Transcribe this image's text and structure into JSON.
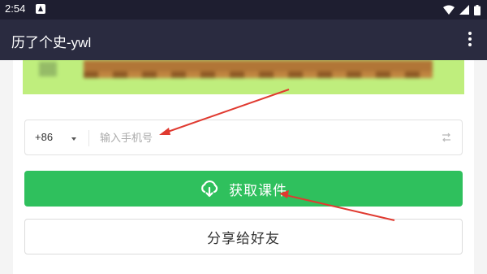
{
  "status_bar": {
    "time": "2:54",
    "icons": [
      "notification-a-icon",
      "wifi-icon",
      "signal-icon",
      "battery-icon"
    ]
  },
  "app_bar": {
    "title": "历了个史-ywl",
    "menu_icon": "more-vert-icon"
  },
  "banner": {
    "image": "blurred-fence-banner"
  },
  "phone_form": {
    "country_code": "+86",
    "placeholder": "输入手机号",
    "value": "",
    "swap_icon": "swap-arrows-icon"
  },
  "buttons": {
    "get_courseware": "获取课件",
    "share": "分享给好友"
  },
  "annotations": {
    "arrow_color": "#e03a30"
  },
  "colors": {
    "status_bar": "#1e1e30",
    "app_bar": "#2a2b40",
    "primary_green": "#2fc05d",
    "banner_green": "#bfee7d"
  }
}
